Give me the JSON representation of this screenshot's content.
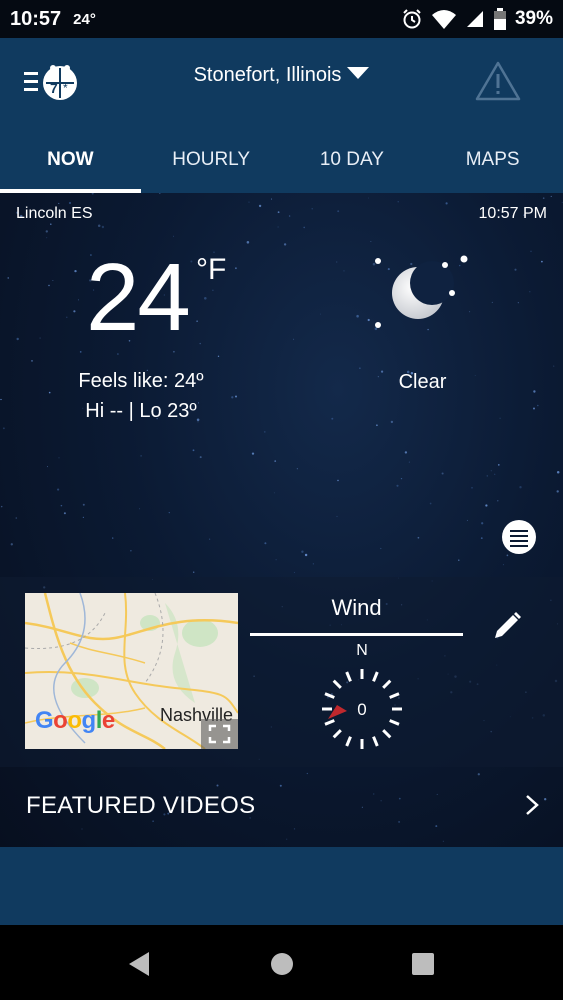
{
  "status_bar": {
    "time": "10:57",
    "temp": "24°",
    "battery": "39%",
    "icons": [
      "alarm-icon",
      "wifi-icon",
      "cell-signal-icon",
      "battery-icon"
    ]
  },
  "header": {
    "location": "Stonefort, Illinois",
    "icons": [
      "menu-logo-icon",
      "alert-icon"
    ]
  },
  "tabs": [
    {
      "label": "NOW",
      "active": true
    },
    {
      "label": "HOURLY",
      "active": false
    },
    {
      "label": "10 DAY",
      "active": false
    },
    {
      "label": "MAPS",
      "active": false
    }
  ],
  "current": {
    "station": "Lincoln ES",
    "time": "10:57 PM",
    "temperature": "24",
    "unit": "°F",
    "feels_like": "Feels like: 24º",
    "hi_lo": "Hi -- | Lo 23º",
    "condition": "Clear",
    "condition_icon": "moon-stars-icon"
  },
  "map": {
    "brand": "Google",
    "city": "Nashville"
  },
  "wind": {
    "title": "Wind",
    "direction_label": "N",
    "speed": "0"
  },
  "featured": {
    "label": "FEATURED VIDEOS"
  },
  "colors": {
    "appbar": "#103a5f",
    "background": "#0a1426",
    "wind_pointer": "#c0282d"
  }
}
